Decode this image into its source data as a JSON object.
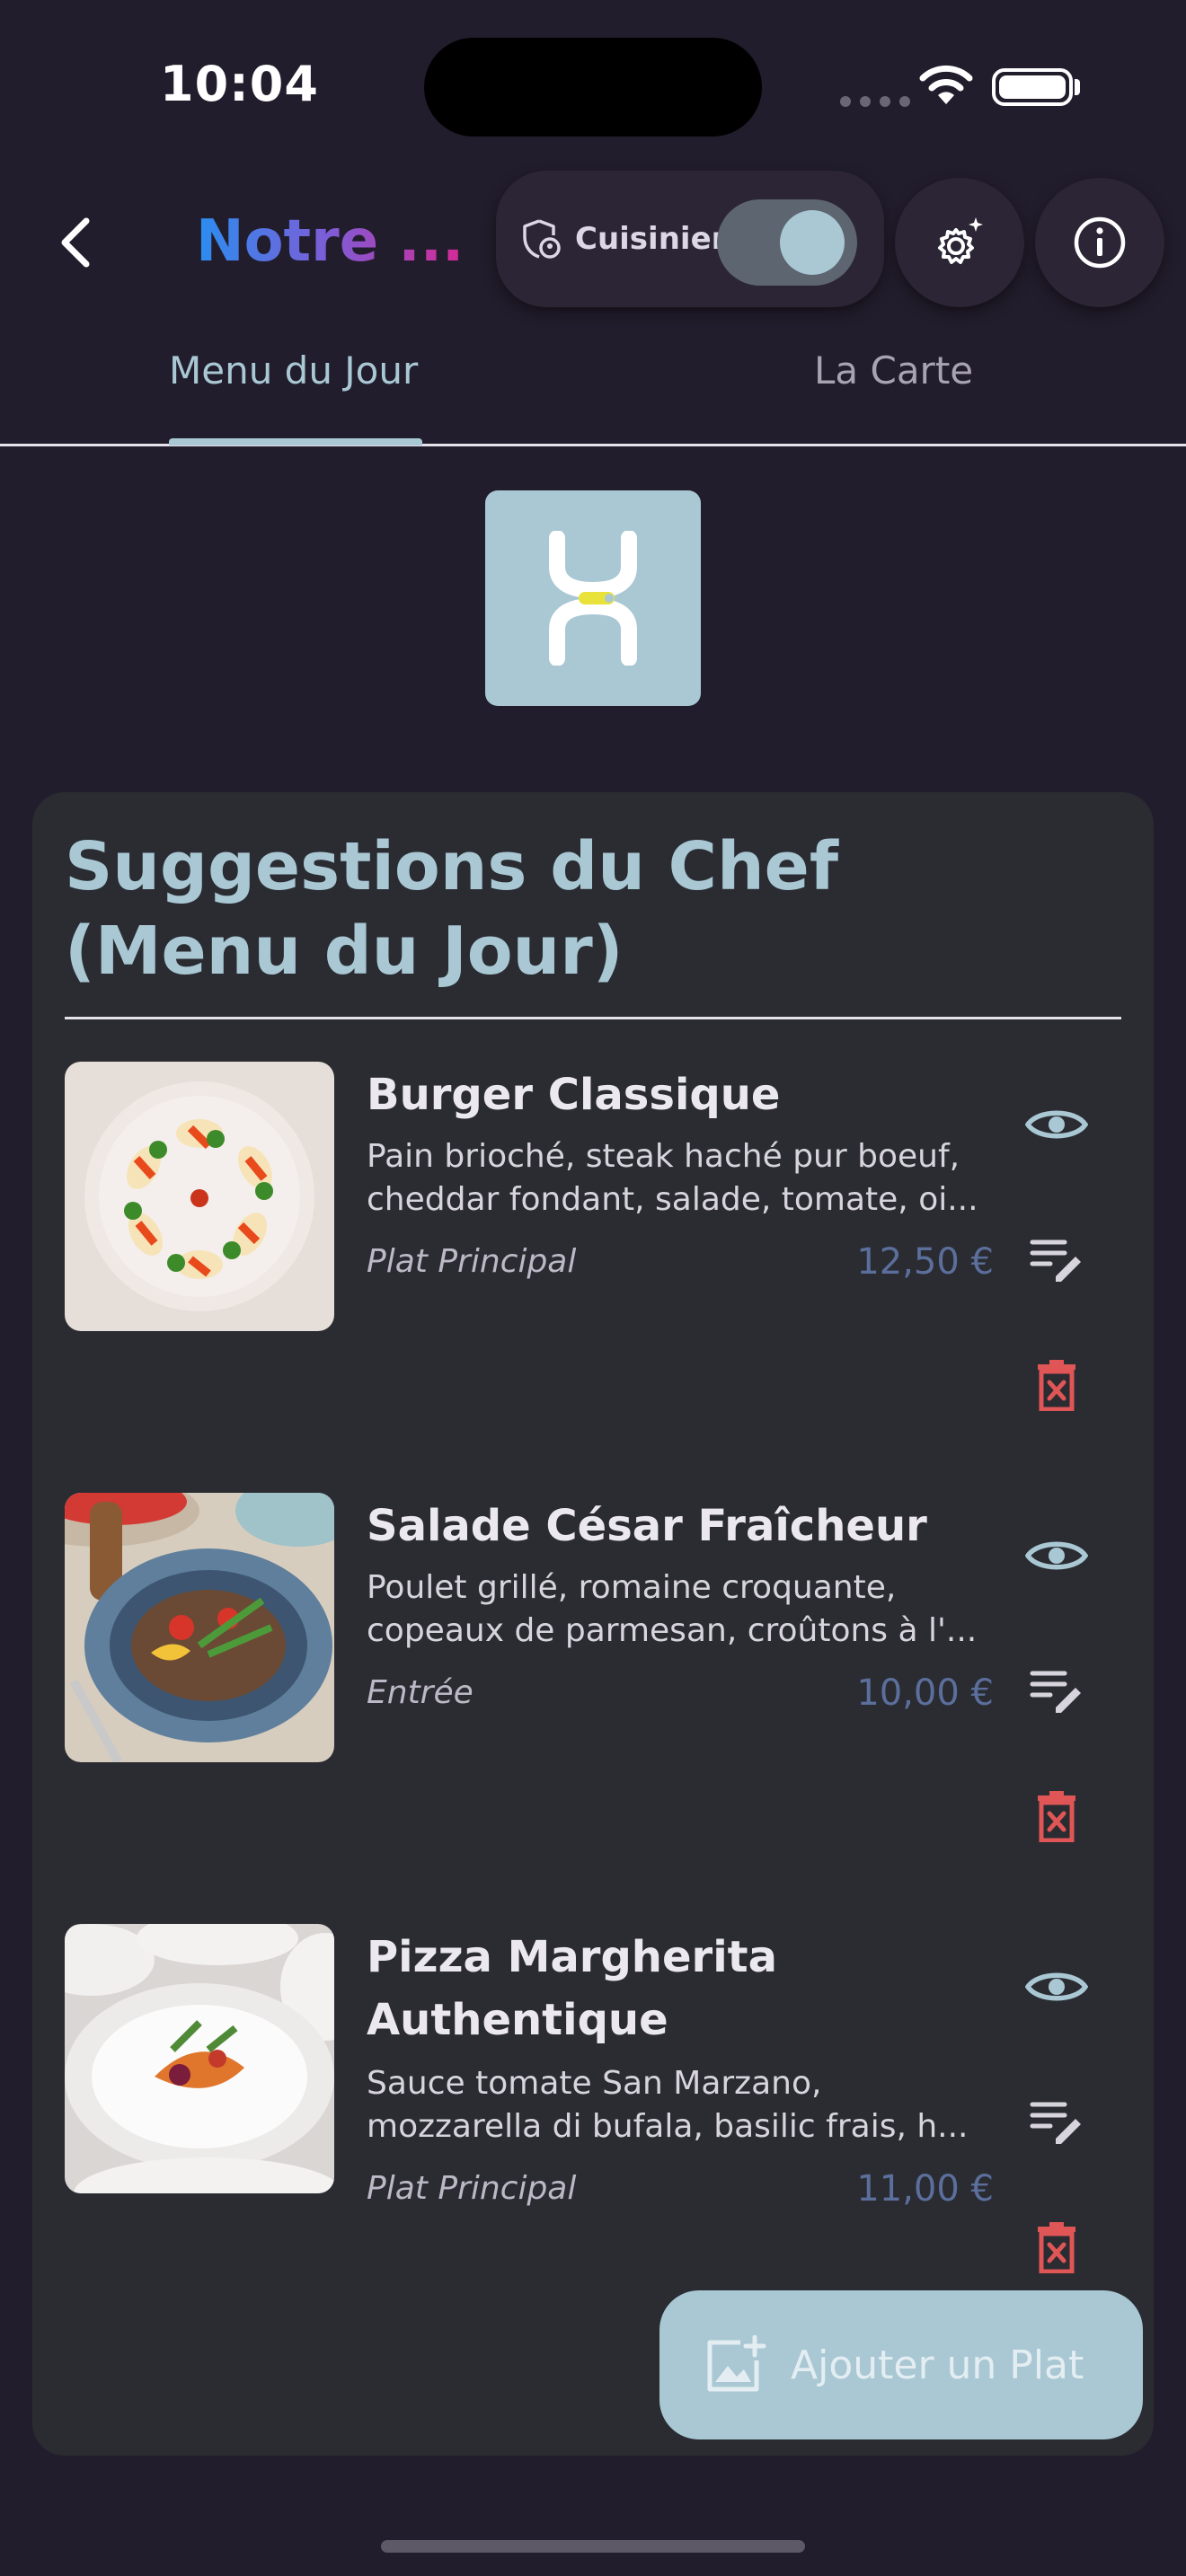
{
  "status": {
    "time": "10:04"
  },
  "header": {
    "title": "Notre ...",
    "cook_toggle_label": "Cuisinier",
    "cook_mode_on": true
  },
  "tabs": [
    {
      "label": "Menu du Jour",
      "active": true
    },
    {
      "label": "La Carte",
      "active": false
    }
  ],
  "section": {
    "title": "Suggestions du Chef (Menu du Jour)"
  },
  "dishes": [
    {
      "name": "Burger Classique",
      "description_line1": "Pain brioché, steak haché pur boeuf,",
      "description_line2": "cheddar fondant, salade, tomate, oi...",
      "category": "Plat Principal",
      "price": "12,50 €"
    },
    {
      "name": "Salade César Fraîcheur",
      "description_line1": "Poulet grillé, romaine croquante,",
      "description_line2": "copeaux de parmesan, croûtons à l'...",
      "category": "Entrée",
      "price": "10,00 €"
    },
    {
      "name_line1": "Pizza Margherita",
      "name_line2": "Authentique",
      "description_line1": "Sauce tomate San Marzano,",
      "description_line2": "mozzarella di bufala, basilic frais, h...",
      "category": "Plat Principal",
      "price": "11,00 €"
    }
  ],
  "fab": {
    "label": "Ajouter un Plat"
  },
  "colors": {
    "background": "#221d2c",
    "accent": "#a9c8d4",
    "card": "#2a2c32",
    "price": "#5c6f9c",
    "delete": "#e05555"
  },
  "icons": {
    "back": "chevron-left-icon",
    "cook": "shield-user-icon",
    "settings": "gear-sparkle-icon",
    "info": "info-icon",
    "view": "eye-icon",
    "edit": "edit-list-icon",
    "delete": "delete-icon",
    "add_photo": "add-photo-icon"
  }
}
